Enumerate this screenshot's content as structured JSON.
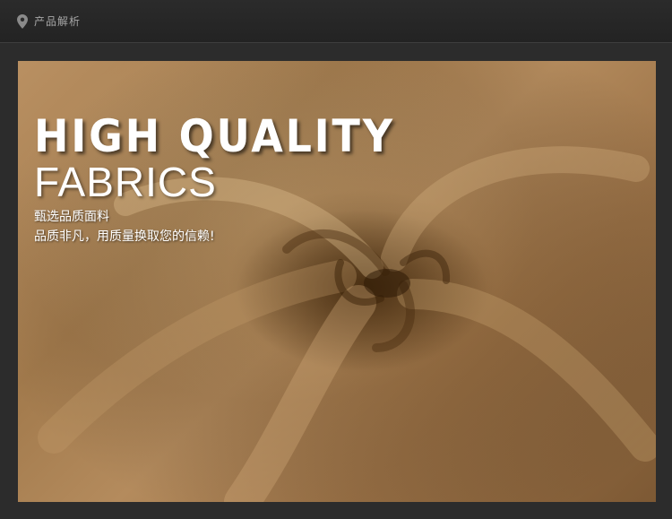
{
  "header": {
    "title": "产品解析",
    "icon": "location-pin-icon"
  },
  "banner": {
    "headline": "HIGH QUALITY",
    "subhead": "FABRICS",
    "line1": "甄选品质面料",
    "line2": "品质非凡，用质量换取您的信赖!"
  },
  "colors": {
    "fabric": "#a98056",
    "background": "#2c2c2c",
    "text": "#ffffff"
  }
}
